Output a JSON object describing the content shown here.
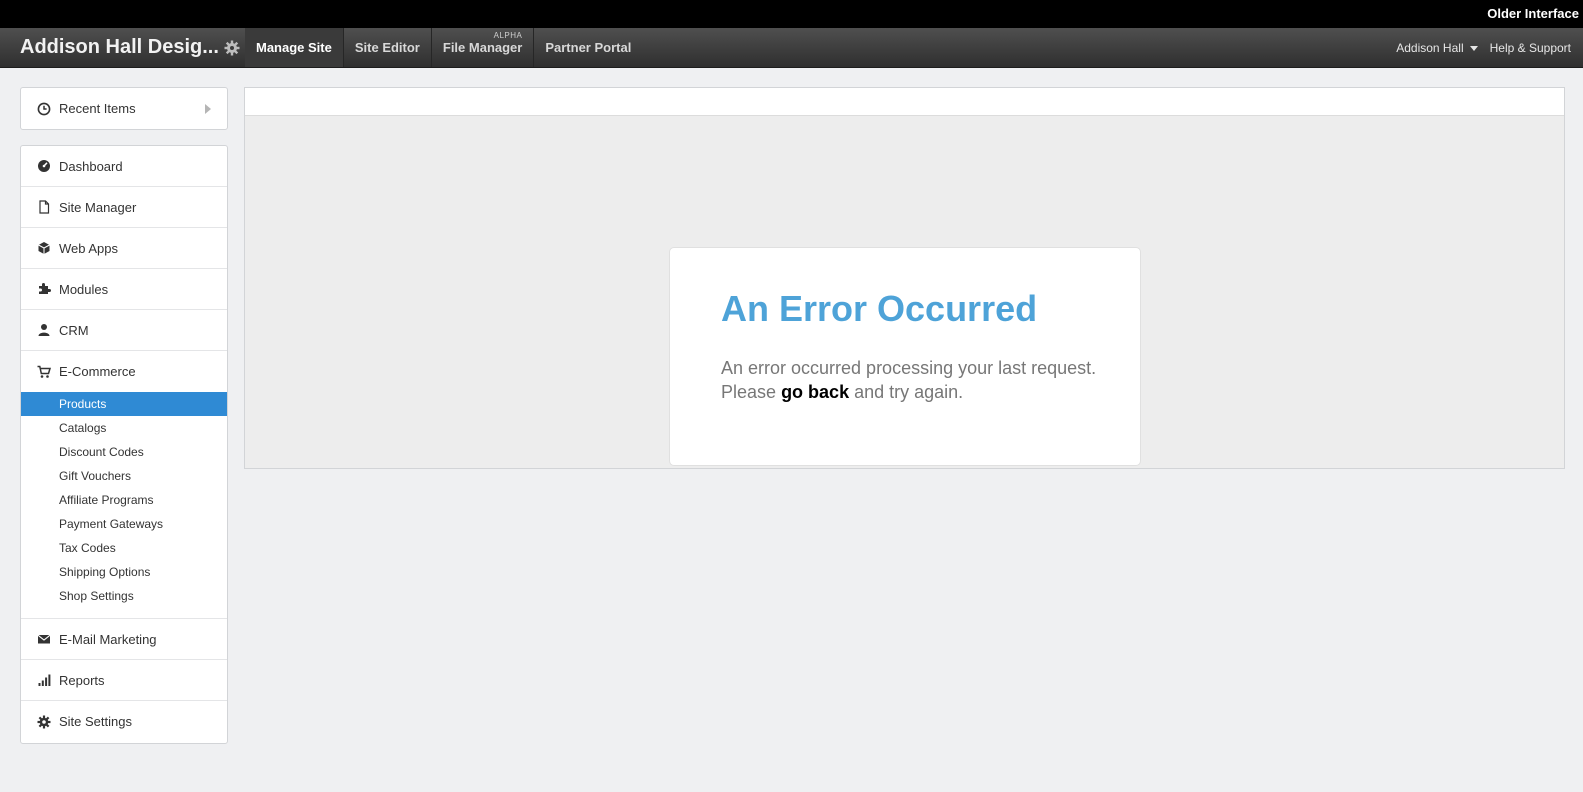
{
  "topbar": {
    "older_interface": "Older Interface"
  },
  "header": {
    "site_name": "Addison Hall Desig...",
    "tabs": [
      {
        "label": "Manage Site",
        "active": true
      },
      {
        "label": "Site Editor"
      },
      {
        "label": "File Manager",
        "badge": "ALPHA"
      },
      {
        "label": "Partner Portal"
      }
    ],
    "user_name": "Addison Hall",
    "help": "Help & Support"
  },
  "sidebar": {
    "recent": "Recent Items",
    "items": [
      {
        "label": "Dashboard",
        "icon": "dashboard-icon"
      },
      {
        "label": "Site Manager",
        "icon": "page-icon"
      },
      {
        "label": "Web Apps",
        "icon": "cube-icon"
      },
      {
        "label": "Modules",
        "icon": "puzzle-icon"
      },
      {
        "label": "CRM",
        "icon": "user-icon"
      },
      {
        "label": "E-Commerce",
        "icon": "cart-icon"
      },
      {
        "label": "E-Mail Marketing",
        "icon": "envelope-icon"
      },
      {
        "label": "Reports",
        "icon": "bar-chart-icon"
      },
      {
        "label": "Site Settings",
        "icon": "gear-icon"
      }
    ],
    "ecommerce_sub": [
      "Products",
      "Catalogs",
      "Discount Codes",
      "Gift Vouchers",
      "Affiliate Programs",
      "Payment Gateways",
      "Tax Codes",
      "Shipping Options",
      "Shop Settings"
    ],
    "active_sub": "Products"
  },
  "error": {
    "title": "An Error Occurred",
    "line1": "An error occurred processing your last request.",
    "please": "Please",
    "go_back": "go back",
    "tail": "and try again."
  },
  "colors": {
    "accent": "#2f8ad4",
    "error_title": "#4ea3d8"
  }
}
